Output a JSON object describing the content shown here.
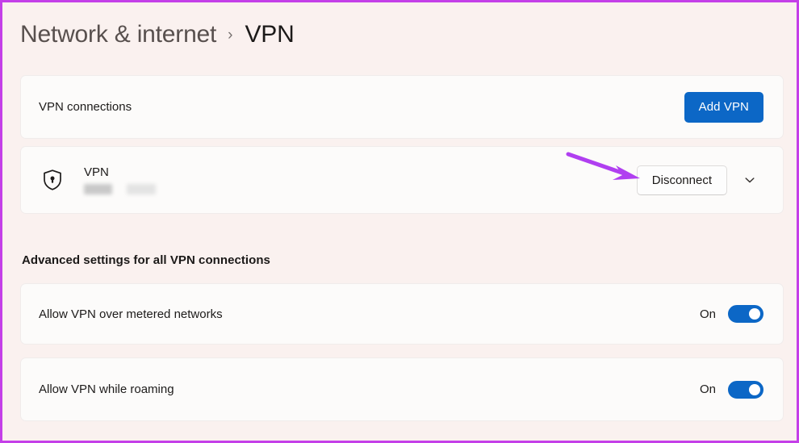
{
  "window": {
    "accent_border_color": "#c43fe8",
    "background_color": "#faf1ef"
  },
  "breadcrumb": {
    "parent": "Network & internet",
    "separator": "›",
    "current": "VPN"
  },
  "vpn_connections_card": {
    "label": "VPN connections",
    "add_button_label": "Add VPN",
    "add_button_color": "#0c67c6"
  },
  "vpn_entry": {
    "icon": "shield-lock-icon",
    "name": "VPN",
    "redacted_line": "",
    "disconnect_button_label": "Disconnect",
    "expand_icon": "chevron-down-icon"
  },
  "annotation": {
    "type": "arrow",
    "color": "#b03ff0",
    "points_to": "disconnect-button"
  },
  "advanced": {
    "heading": "Advanced settings for all VPN connections",
    "settings": [
      {
        "label": "Allow VPN over metered networks",
        "state_label": "On",
        "enabled": true
      },
      {
        "label": "Allow VPN while roaming",
        "state_label": "On",
        "enabled": true
      }
    ]
  }
}
